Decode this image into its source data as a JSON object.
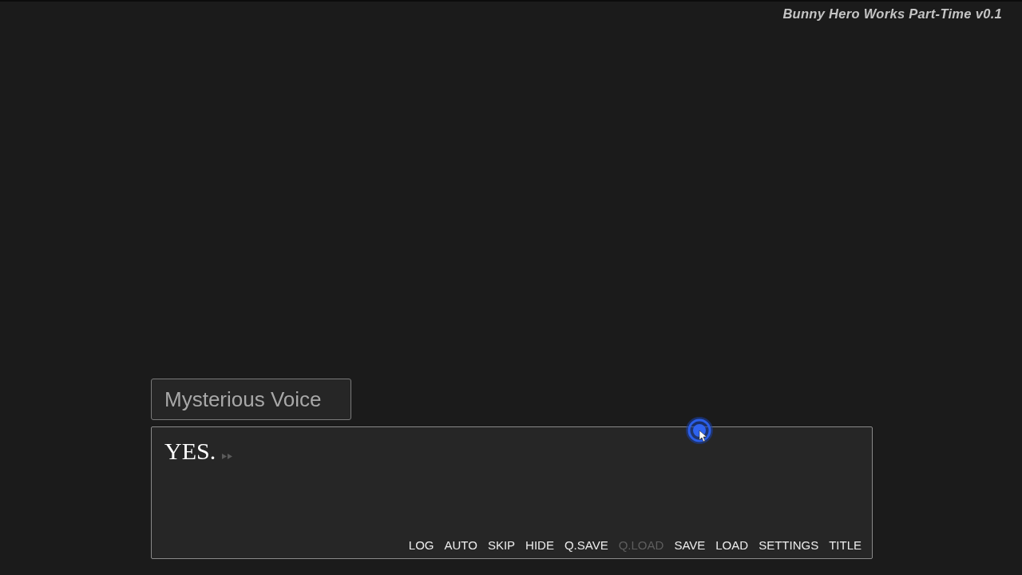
{
  "title": "Bunny Hero Works Part-Time v0.1",
  "dialogue": {
    "speaker": "Mysterious Voice",
    "text": "YES."
  },
  "quick_menu": [
    {
      "label": "LOG",
      "disabled": false
    },
    {
      "label": "AUTO",
      "disabled": false
    },
    {
      "label": "SKIP",
      "disabled": false
    },
    {
      "label": "HIDE",
      "disabled": false
    },
    {
      "label": "Q.SAVE",
      "disabled": false
    },
    {
      "label": "Q.LOAD",
      "disabled": true
    },
    {
      "label": "SAVE",
      "disabled": false
    },
    {
      "label": "LOAD",
      "disabled": false
    },
    {
      "label": "SETTINGS",
      "disabled": false
    },
    {
      "label": "TITLE",
      "disabled": false
    }
  ]
}
